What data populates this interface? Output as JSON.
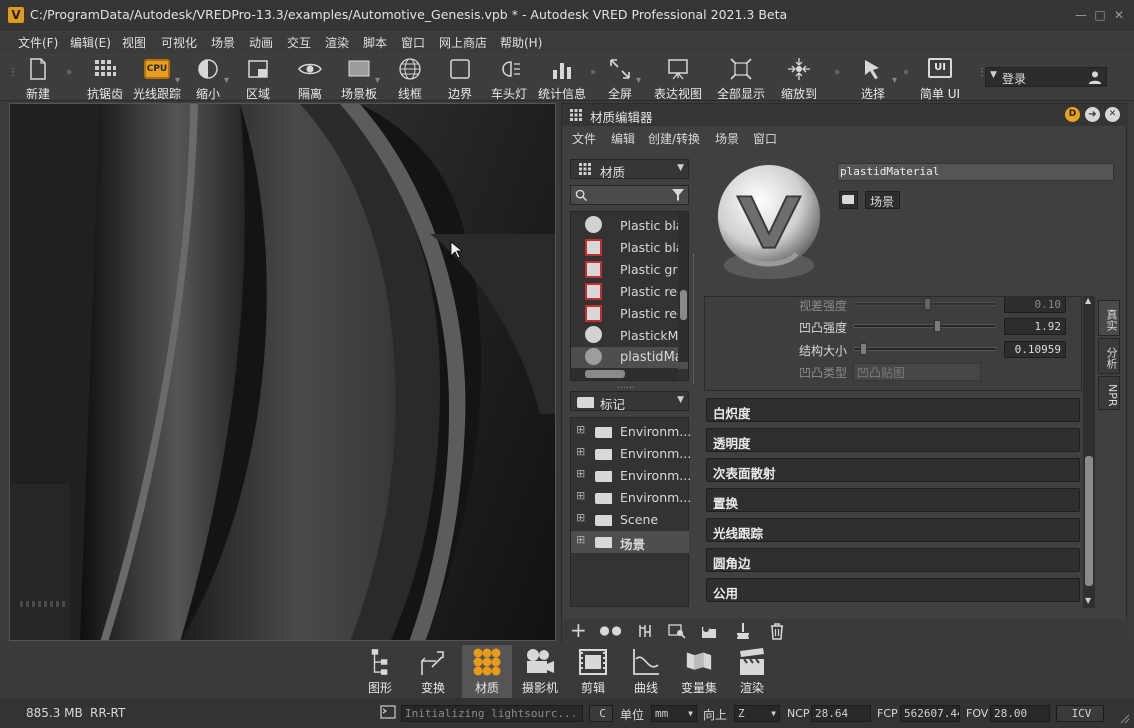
{
  "window": {
    "title": "C:/ProgramData/Autodesk/VREDPro-13.3/examples/Automotive_Genesis.vpb * - Autodesk VRED Professional 2021.3 Beta",
    "logo": "V"
  },
  "menu": [
    "文件(F)",
    "编辑(E)",
    "视图",
    "可视化",
    "场景",
    "动画",
    "交互",
    "渲染",
    "脚本",
    "窗口",
    "网上商店",
    "帮助(H)"
  ],
  "toolbar": {
    "items": [
      "新建",
      "抗锯齿",
      "光线跟踪",
      "缩小",
      "区域",
      "隔离",
      "场景板",
      "线框",
      "边界",
      "车头灯",
      "统计信息",
      "全屏",
      "表达视图",
      "全部显示",
      "缩放到",
      "选择",
      "简单 UI"
    ],
    "cpu_badge": "CPU",
    "ui_badge": "UI",
    "login": "登录"
  },
  "material_editor": {
    "title": "材质编辑器",
    "menu": [
      "文件",
      "编辑",
      "创建/转换",
      "场景",
      "窗口"
    ],
    "filter_combo": "材质",
    "material_list": [
      "Plastic bla",
      "Plastic bla",
      "Plastic gre",
      "Plastic rec",
      "Plastic rec",
      "PlastickM",
      "plastidMa"
    ],
    "tag_combo": "标记",
    "tag_list": [
      "Environm...",
      "Environm...",
      "Environm...",
      "Environm...",
      "Scene",
      "场景"
    ],
    "material_name": "plastidMaterial",
    "scene_tag": "场景",
    "properties": [
      {
        "label": "视差强度",
        "value": "0.10",
        "fraction": 0.5
      },
      {
        "label": "凹凸强度",
        "value": "1.92",
        "fraction": 0.58
      },
      {
        "label": "结构大小",
        "value": "0.10959",
        "fraction": 0.05
      }
    ],
    "bump_type_label": "凹凸类型",
    "bump_type_value": "凹凸贴图",
    "sections": [
      "白炽度",
      "透明度",
      "次表面散射",
      "置换",
      "光线跟踪",
      "圆角边",
      "公用"
    ],
    "side_tabs": [
      "真实",
      "分析",
      "NPR"
    ]
  },
  "dock": [
    "图形",
    "变换",
    "材质",
    "摄影机",
    "剪辑",
    "曲线",
    "变量集",
    "渲染"
  ],
  "status": {
    "memory": "885.3 MB",
    "mode": "RR-RT",
    "message": "Initializing lightsourc...",
    "unit_label": "单位",
    "unit_value": "mm",
    "up_label": "向上",
    "up_value": "Z",
    "ncp_label": "NCP",
    "ncp_value": "28.64",
    "fcp_label": "FCP",
    "fcp_value": "562607.44",
    "fov_label": "FOV",
    "fov_value": "28.00",
    "icv": "ICV",
    "c_btn": "C"
  },
  "colors": {
    "accent": "#e29a1c",
    "panel": "#404040",
    "dark": "#2f2f2f"
  }
}
